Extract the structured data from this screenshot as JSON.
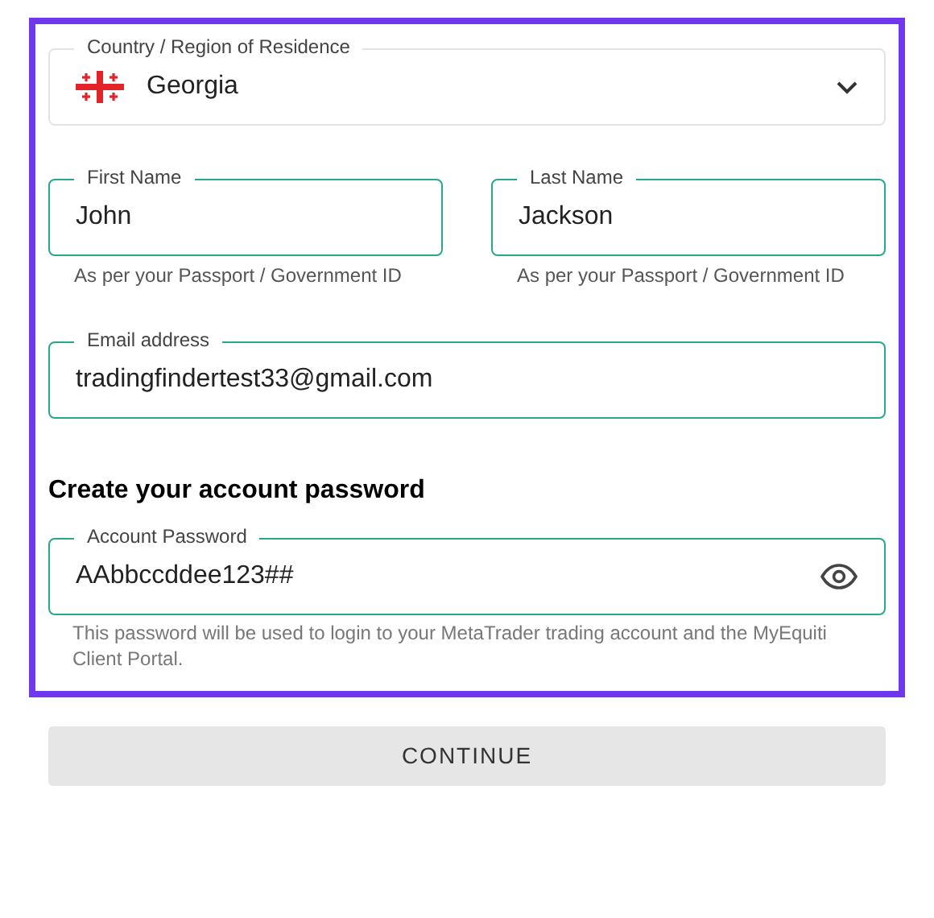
{
  "form": {
    "fields": [
      {
        "kind": "select",
        "label": "Country / Region of Residence",
        "value": "Georgia"
      },
      {
        "kind": "text",
        "label": "First Name",
        "value": "John",
        "helper": "As per your Passport / Government ID"
      },
      {
        "kind": "text",
        "label": "Last Name",
        "value": "Jackson",
        "helper": "As per your Passport / Government ID"
      },
      {
        "kind": "text",
        "label": "Email address",
        "value": "tradingfindertest33@gmail.com"
      }
    ],
    "password_heading": "Create your account password",
    "password": {
      "label": "Account Password",
      "value": "AAbbccddee123##",
      "visible": true,
      "helper": "This password will be used to login to your MetaTrader trading account and the MyEquiti Client Portal."
    }
  },
  "continue_button": "CONTINUE"
}
